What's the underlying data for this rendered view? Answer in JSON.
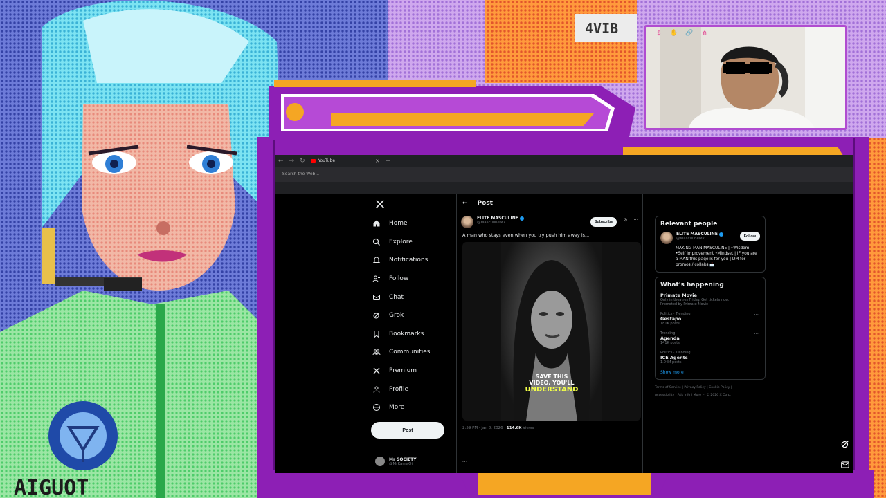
{
  "colors": {
    "accent": "#1d9bf0",
    "frame_purple": "#8d1fb5",
    "frame_orange": "#f5a623",
    "caption_yellow": "#f2ff49",
    "text_primary": "#e7e9ea",
    "text_secondary": "#71767b"
  },
  "backdrop": {
    "sign_text": "AIGUOT",
    "top_sign": "4VIB"
  },
  "browser": {
    "tab_title": "YouTube",
    "tab_icon": "youtube-icon",
    "new_tab": "+",
    "close_tab": "×",
    "address_placeholder": "Search the Web..."
  },
  "nav": {
    "logo": "x-logo-icon",
    "items": [
      {
        "label": "Home",
        "icon": "home-icon"
      },
      {
        "label": "Explore",
        "icon": "search-icon"
      },
      {
        "label": "Notifications",
        "icon": "bell-icon"
      },
      {
        "label": "Follow",
        "icon": "add-person-icon"
      },
      {
        "label": "Chat",
        "icon": "mail-icon"
      },
      {
        "label": "Grok",
        "icon": "grok-icon"
      },
      {
        "label": "Bookmarks",
        "icon": "bookmark-icon"
      },
      {
        "label": "Communities",
        "icon": "people-icon"
      },
      {
        "label": "Premium",
        "icon": "x-icon"
      },
      {
        "label": "Profile",
        "icon": "person-icon"
      },
      {
        "label": "More",
        "icon": "more-circle-icon"
      }
    ],
    "post_button": "Post",
    "account": {
      "name": "Mr SOCIETY",
      "handle": "@MrKamaQi",
      "more": "···"
    }
  },
  "post": {
    "header_title": "Post",
    "author_name": "ELITE MASCULINE",
    "author_handle": "@MasculineM7",
    "subscribe_label": "Subscribe",
    "text": "A man who stays even when you try push him away is...",
    "caption_line1": "SAVE THIS",
    "caption_line2": "VIDEO, YOU'LL",
    "caption_line3": "UNDERSTAND",
    "timestamp": "2:59 PM · Jan 8, 2026 ·",
    "views_count": "114.6K",
    "views_label": "Views"
  },
  "relevant": {
    "heading": "Relevant people",
    "name": "ELITE MASCULINE",
    "handle": "@MasculineM7",
    "follow_label": "Follow",
    "bio": "MAKING MAN MASCULINE | •Wisdom •Self Improvement •Mindset | IF you are a MAN this page is for you | DM for promos / collabs 📩"
  },
  "happening": {
    "heading": "What's happening",
    "trends": [
      {
        "context": "",
        "title": "Primate Movie",
        "sub": "Only in theatres Friday. Get tickets now.",
        "extra": "Promoted by Primate Movie"
      },
      {
        "context": "Politics · Trending",
        "title": "Gestapo",
        "sub": "181K posts",
        "extra": ""
      },
      {
        "context": "Trending",
        "title": "Agenda",
        "sub": "141K posts",
        "extra": ""
      },
      {
        "context": "Politics · Trending",
        "title": "ICE Agents",
        "sub": "1.04M posts",
        "extra": ""
      }
    ],
    "show_more": "Show more"
  },
  "footer": {
    "line1": "Terms of Service  |  Privacy Policy  |  Cookie Policy  |",
    "line2": "Accessibility  |  Ads info  |  More ···  © 2026 X Corp."
  },
  "webcam": {
    "icons": [
      "dollar-icon",
      "hand-icon",
      "link-icon",
      "share-icon"
    ]
  },
  "side_icons": [
    "grok-icon",
    "mail-icon"
  ]
}
